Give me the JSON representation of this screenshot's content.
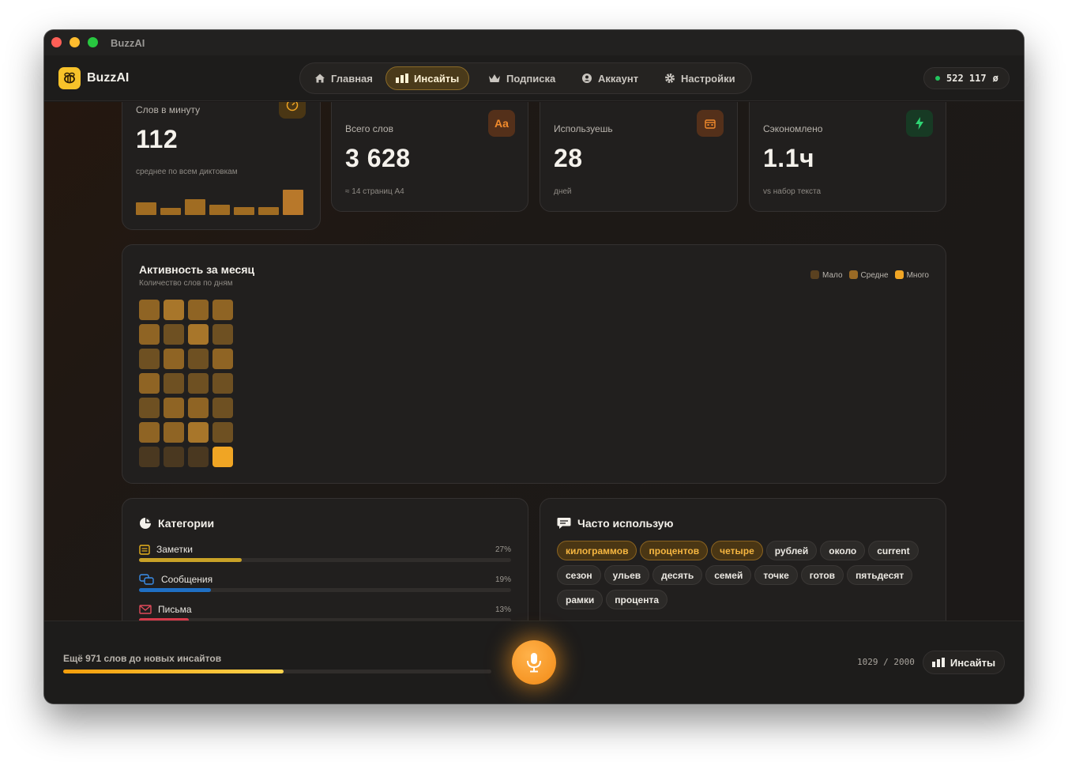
{
  "window": {
    "title": "BuzzAI"
  },
  "header": {
    "brand": "BuzzAI",
    "nav": [
      {
        "label": "Главная",
        "icon": "home-icon",
        "active": false
      },
      {
        "label": "Инсайты",
        "icon": "bar-chart-icon",
        "active": true
      },
      {
        "label": "Подписка",
        "icon": "crown-icon",
        "active": false
      },
      {
        "label": "Аккаунт",
        "icon": "user-circle-icon",
        "active": false
      },
      {
        "label": "Настройки",
        "icon": "gear-icon",
        "active": false
      }
    ],
    "counter": "522 117",
    "counter_symbol": "ø"
  },
  "stats": [
    {
      "label": "Слов в минуту",
      "value": "112",
      "sub": "среднее по всем диктовкам",
      "icon": "speedometer-icon"
    },
    {
      "label": "Всего слов",
      "value": "3 628",
      "sub": "≈ 14 страниц А4",
      "icon": "text-aa-icon",
      "icon_text": "Aa"
    },
    {
      "label": "Используешь",
      "value": "28",
      "sub": "дней",
      "icon": "calendar-icon"
    },
    {
      "label": "Сэкономлено",
      "value": "1.1ч",
      "sub": "vs набор текста",
      "icon": "lightning-icon"
    }
  ],
  "wpm_bars": [
    0.5,
    0.28,
    0.62,
    0.41,
    0.3,
    0.3,
    1.0
  ],
  "activity": {
    "title": "Активность за месяц",
    "subtitle": "Количество слов по дням",
    "legend": [
      {
        "label": "Мало",
        "color": "#5a4120"
      },
      {
        "label": "Средне",
        "color": "#9a6a25"
      },
      {
        "label": "Много",
        "color": "#f0a524"
      }
    ],
    "levels": [
      [
        2,
        3,
        2,
        2
      ],
      [
        2,
        1,
        3,
        1
      ],
      [
        1,
        2,
        1,
        2
      ],
      [
        2,
        1,
        1,
        1
      ],
      [
        1,
        2,
        2,
        1
      ],
      [
        2,
        2,
        3,
        1
      ],
      [
        0,
        0,
        0,
        4
      ]
    ]
  },
  "categories": {
    "title": "Категории",
    "items": [
      {
        "label": "Заметки",
        "pct": "27%",
        "value": 0.27,
        "color": "#c9a227",
        "icon": "note-icon",
        "icon_color": "#e8b21c"
      },
      {
        "label": "Сообщения",
        "pct": "19%",
        "value": 0.19,
        "color": "#1f6fc4",
        "icon": "chat-bubbles-icon",
        "icon_color": "#3b8ee8"
      },
      {
        "label": "Письма",
        "pct": "13%",
        "value": 0.13,
        "color": "#d63a4a",
        "icon": "envelope-icon",
        "icon_color": "#e04a5a"
      }
    ]
  },
  "frequent": {
    "title": "Часто использую",
    "words": [
      {
        "text": "килограммов",
        "hot": true
      },
      {
        "text": "процентов",
        "hot": true
      },
      {
        "text": "четыре",
        "hot": true
      },
      {
        "text": "рублей",
        "hot": false
      },
      {
        "text": "около",
        "hot": false
      },
      {
        "text": "current",
        "hot": false
      },
      {
        "text": "сезон",
        "hot": false
      },
      {
        "text": "ульев",
        "hot": false
      },
      {
        "text": "десять",
        "hot": false
      },
      {
        "text": "семей",
        "hot": false
      },
      {
        "text": "точке",
        "hot": false
      },
      {
        "text": "готов",
        "hot": false
      },
      {
        "text": "пятьдесят",
        "hot": false
      },
      {
        "text": "рамки",
        "hot": false
      },
      {
        "text": "процента",
        "hot": false
      }
    ]
  },
  "footer": {
    "progress_label": "Ещё 971 слов до новых инсайтов",
    "progress": 0.5145,
    "count": "1029 / 2000",
    "insights_label": "Инсайты"
  }
}
